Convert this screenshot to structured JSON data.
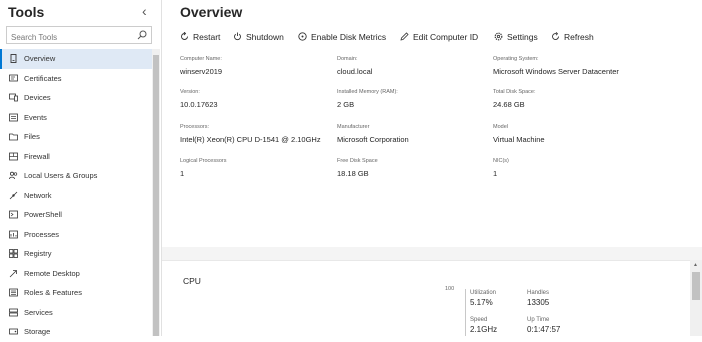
{
  "sidebar": {
    "title": "Tools",
    "search_placeholder": "Search Tools",
    "items": [
      {
        "label": "Overview",
        "icon": "computer-icon"
      },
      {
        "label": "Certificates",
        "icon": "certificate-icon"
      },
      {
        "label": "Devices",
        "icon": "devices-icon"
      },
      {
        "label": "Events",
        "icon": "events-icon"
      },
      {
        "label": "Files",
        "icon": "folder-icon"
      },
      {
        "label": "Firewall",
        "icon": "firewall-icon"
      },
      {
        "label": "Local Users & Groups",
        "icon": "users-icon"
      },
      {
        "label": "Network",
        "icon": "network-icon"
      },
      {
        "label": "PowerShell",
        "icon": "powershell-icon"
      },
      {
        "label": "Processes",
        "icon": "processes-icon"
      },
      {
        "label": "Registry",
        "icon": "registry-icon"
      },
      {
        "label": "Remote Desktop",
        "icon": "remote-desktop-icon"
      },
      {
        "label": "Roles & Features",
        "icon": "roles-icon"
      },
      {
        "label": "Services",
        "icon": "services-icon"
      },
      {
        "label": "Storage",
        "icon": "storage-icon"
      }
    ]
  },
  "main": {
    "title": "Overview",
    "toolbar": {
      "restart": "Restart",
      "shutdown": "Shutdown",
      "disk_metrics": "Enable Disk Metrics",
      "edit_id": "Edit Computer ID",
      "settings": "Settings",
      "refresh": "Refresh"
    },
    "fields": {
      "computer_name": {
        "label": "Computer Name:",
        "value": "winserv2019"
      },
      "domain": {
        "label": "Domain:",
        "value": "cloud.local"
      },
      "os": {
        "label": "Operating System:",
        "value": "Microsoft Windows Server Datacenter"
      },
      "version": {
        "label": "Version:",
        "value": "10.0.17623"
      },
      "memory": {
        "label": "Installed Memory (RAM):",
        "value": "2 GB"
      },
      "disk_total": {
        "label": "Total Disk Space:",
        "value": "24.68 GB"
      },
      "processors": {
        "label": "Processors:",
        "value": "Intel(R) Xeon(R) CPU D-1541 @ 2.10GHz"
      },
      "manufacturer": {
        "label": "Manufacturer",
        "value": "Microsoft Corporation"
      },
      "model": {
        "label": "Model",
        "value": "Virtual Machine"
      },
      "logical": {
        "label": "Logical Processors",
        "value": "1"
      },
      "disk_free": {
        "label": "Free Disk Space",
        "value": "18.18 GB"
      },
      "nics": {
        "label": "NIC(s)",
        "value": "1"
      }
    },
    "cpu": {
      "title": "CPU",
      "axis_max": "100",
      "utilization_label": "Utilization",
      "utilization_value": "5.17%",
      "handles_label": "Handles",
      "handles_value": "13305",
      "speed_label": "Speed",
      "speed_value": "2.1GHz",
      "uptime_label": "Up Time",
      "uptime_value": "0:1:47:57"
    }
  },
  "colors": {
    "accent": "#0078d4",
    "active_bg": "#dfe9f5"
  }
}
